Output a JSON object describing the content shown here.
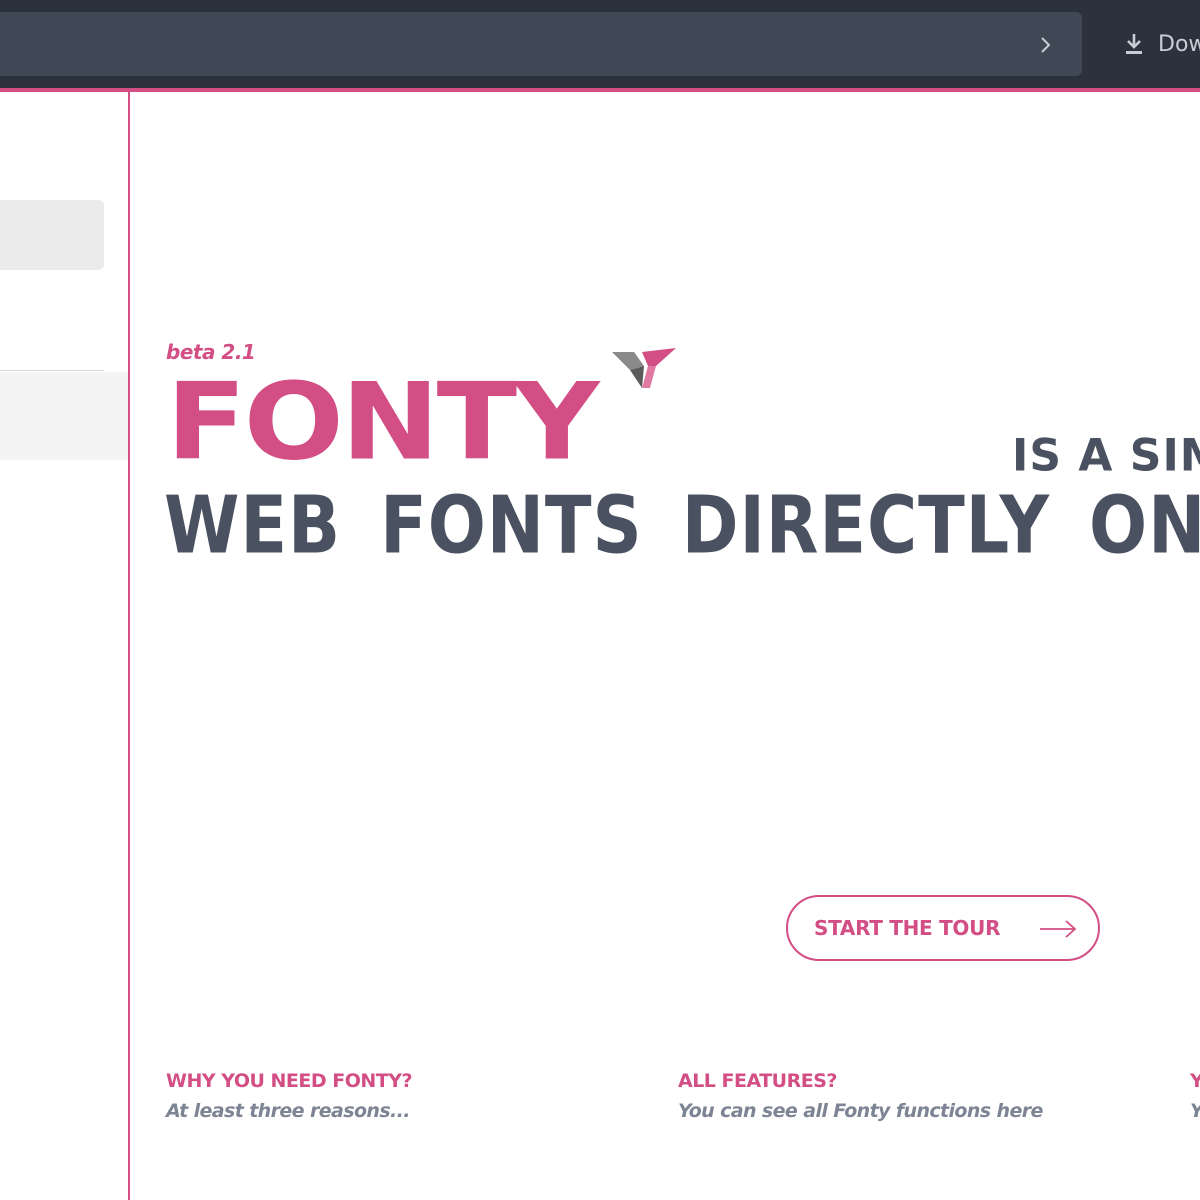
{
  "browser": {
    "download_label": "Dow"
  },
  "hero": {
    "beta_label": "beta 2.1",
    "logo_text": "FONTY",
    "tagline_line1": "IS A SIMP",
    "tagline_line2": "WEB FONTS DIRECTLY ON"
  },
  "tour_button": {
    "label": "START THE TOUR"
  },
  "features": [
    {
      "title": "WHY YOU NEED FONTY?",
      "subtitle": "At least three reasons..."
    },
    {
      "title": "ALL FEATURES?",
      "subtitle": "You can see all Fonty functions here"
    },
    {
      "title": "Y",
      "subtitle": "Y"
    }
  ],
  "colors": {
    "accent": "#d24e84",
    "text_dark": "#4a5160",
    "topbar": "#2c323d",
    "urlbar": "#404755"
  },
  "icons": {
    "url_chevron": "chevron-right-icon",
    "download": "download-icon",
    "logo_mark": "fonty-logo-mark-icon",
    "tour_arrow": "arrow-right-icon"
  }
}
